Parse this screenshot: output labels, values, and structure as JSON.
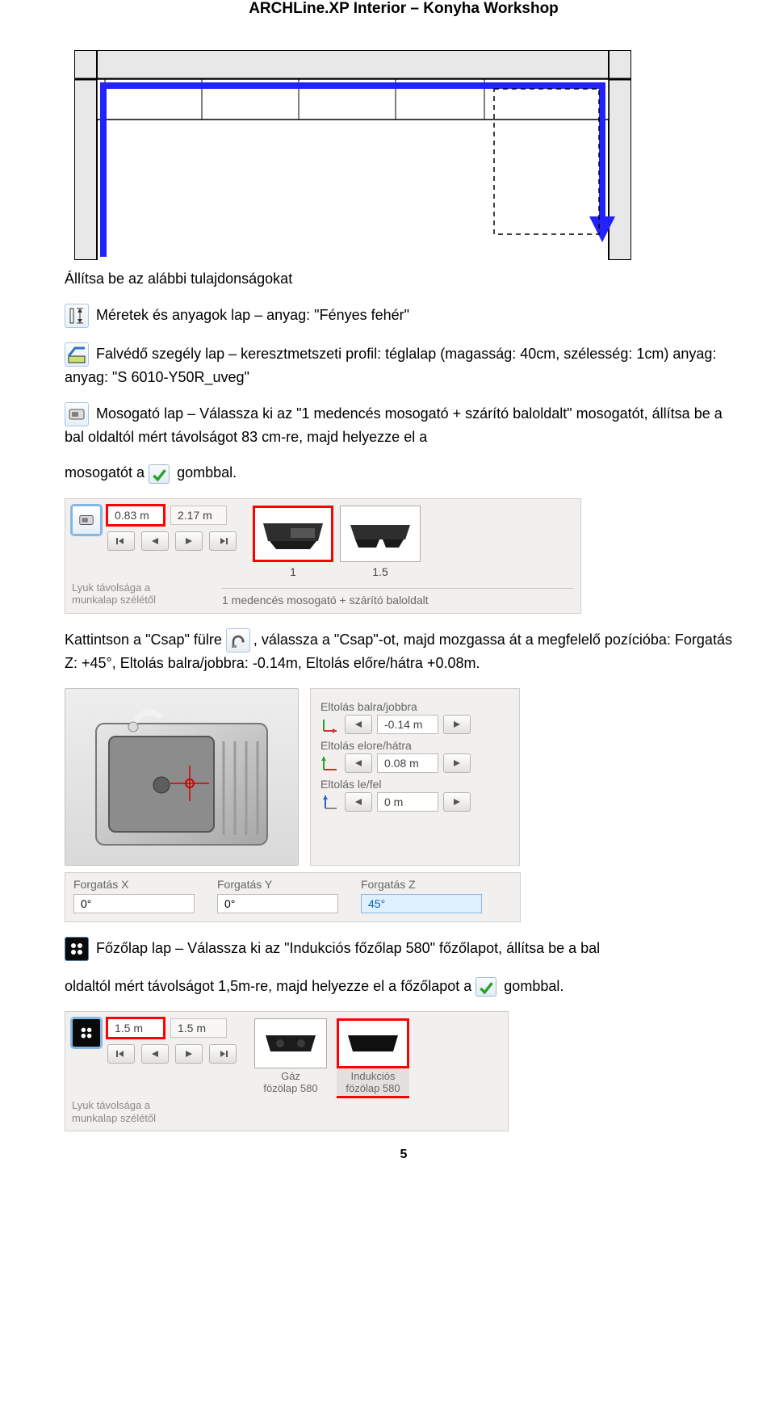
{
  "doc": {
    "title": "ARCHLine.XP Interior – Konyha Workshop",
    "page_number": "5"
  },
  "section1": {
    "heading": "Állítsa be az alábbi tulajdonságokat",
    "p1": "Méretek és anyagok lap – anyag: \"Fényes fehér\"",
    "p2": "Falvédő szegély lap – keresztmetszeti profil: téglalap (magasság: 40cm, szélesség: 1cm) anyag: anyag: \"S 6010-Y50R_uveg\"",
    "p3": "Mosogató lap – Válassza ki az \"1 medencés mosogató + szárító baloldalt\" mosogatót, állítsa be a bal oldaltól mért távolságot 83 cm-re,  majd helyezze el a",
    "p3_tail_a": "mosogatót a",
    "p3_tail_b": "gombbal."
  },
  "sink_ui": {
    "val_left": "0.83 m",
    "val_right": "2.17 m",
    "caption_left_line1": "Lyuk távolsága a",
    "caption_left_line2": "munkalap szélétől",
    "preview_labels": [
      "1",
      "1.5"
    ],
    "desc": "1 medencés mosogató + szárító baloldalt"
  },
  "tap_text": {
    "before": "Kattintson a \"Csap\" fülre ",
    "after": ", válassza a \"Csap\"-ot, majd mozgassa át a megfelelő pozícióba: Forgatás Z: +45°, Eltolás balra/jobbra: -0.14m, Eltolás előre/hátra +0.08m."
  },
  "tap_ui": {
    "lbl_lr": "Eltolás balra/jobbra",
    "val_lr": "-0.14 m",
    "lbl_fb": "Eltolás elore/hátra",
    "val_fb": "0.08 m",
    "lbl_ud": "Eltolás le/fel",
    "val_ud": "0 m",
    "rot_x_lbl": "Forgatás X",
    "rot_x_val": "0°",
    "rot_y_lbl": "Forgatás Y",
    "rot_y_val": "0°",
    "rot_z_lbl": "Forgatás Z",
    "rot_z_val": "45°"
  },
  "cooktop_text": {
    "p1a": "Főzőlap lap – Válassza ki az \"Indukciós főzőlap 580\" főzőlapot, állítsa be a bal",
    "p1b": "oldaltól mért távolságot 1,5m-re,  majd helyezze el a főzőlapot a",
    "p1c": "gombbal."
  },
  "cook_ui": {
    "val_left": "1.5 m",
    "val_right": "1.5 m",
    "tile1_l1": "Gáz",
    "tile1_l2": "fözölap 580",
    "tile2_l1": "Indukciós",
    "tile2_l2": "fözölap 580",
    "caption_left_line1": "Lyuk távolsága a",
    "caption_left_line2": "munkalap szélétől"
  }
}
